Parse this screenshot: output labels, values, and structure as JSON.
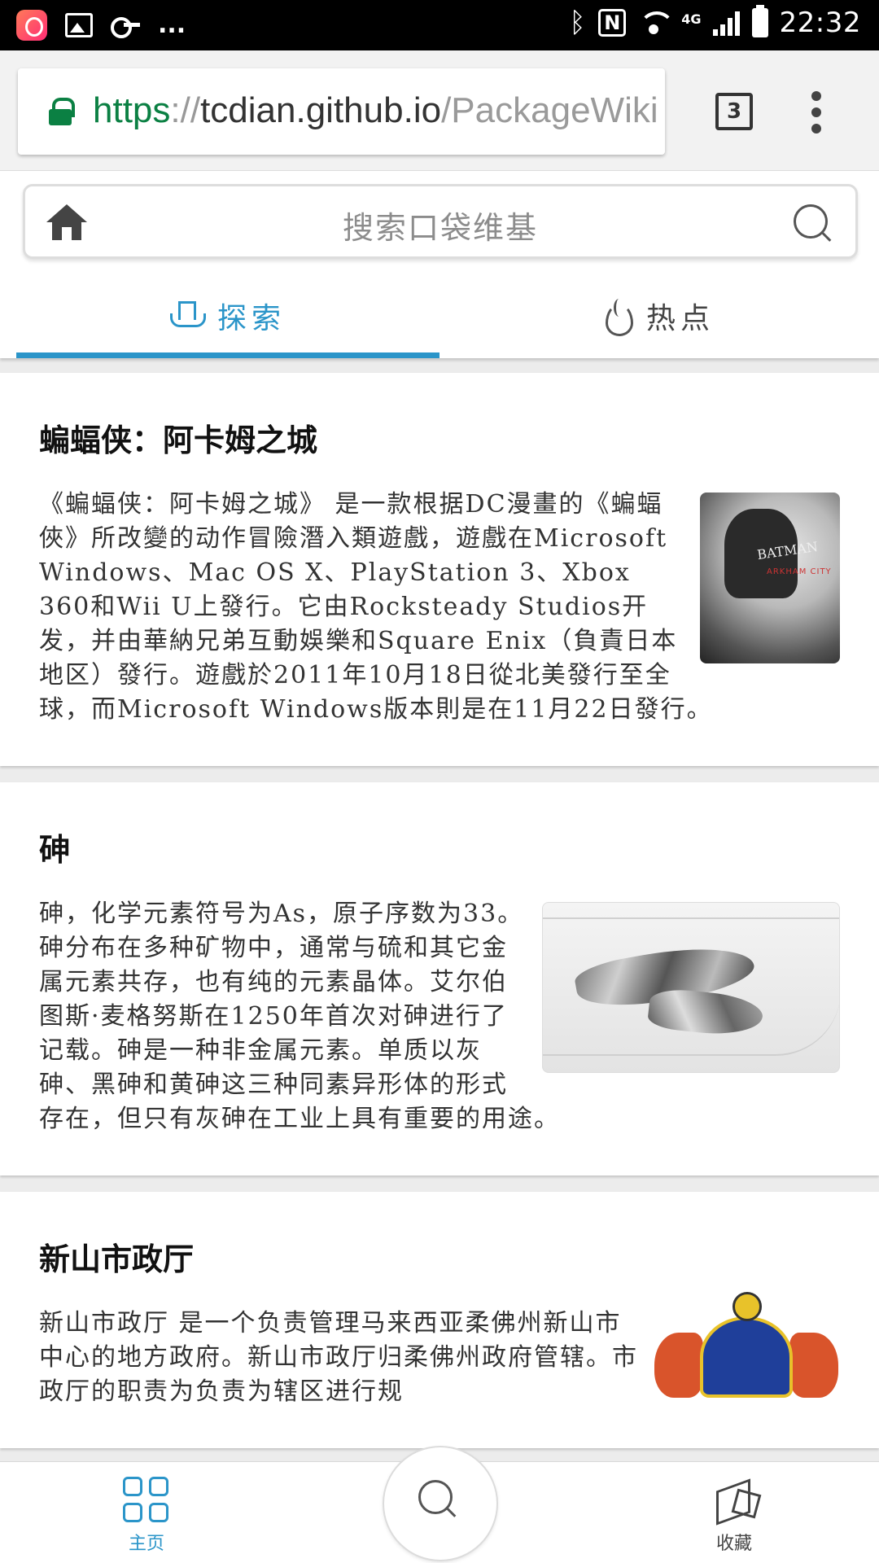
{
  "status_bar": {
    "overflow": "...",
    "network": "4G",
    "time": "22:32",
    "nfc": "N"
  },
  "browser": {
    "url_scheme": "https",
    "url_separator": "://",
    "url_host": "tcdian.github.io",
    "url_path": "/PackageWiki",
    "tab_count": "3"
  },
  "search": {
    "placeholder": "搜索口袋维基"
  },
  "tabs": [
    {
      "label": "探索",
      "icon": "ship-icon",
      "active": true
    },
    {
      "label": "热点",
      "icon": "flame-icon",
      "active": false
    }
  ],
  "colors": {
    "accent": "#2b95c9",
    "secure_green": "#0b8043"
  },
  "articles": [
    {
      "title": "蝙蝠侠：阿卡姆之城",
      "summary": "《蝙蝠侠：阿卡姆之城》 是一款根据DC漫畫的《蝙蝠俠》所改變的动作冒險潛入類遊戲，遊戲在Microsoft Windows、Mac OS X、PlayStation 3、Xbox 360和Wii U上發行。它由Rocksteady Studios开发，并由華納兄弟互動娛樂和Square Enix（負責日本地区）發行。遊戲於2011年10月18日從北美發行至全球，而Microsoft Windows版本則是在11月22日發行。",
      "image_text": "BATMAN",
      "image_subtext": "ARKHAM CITY"
    },
    {
      "title": "砷",
      "summary": "砷，化学元素符号为As，原子序数为33。砷分布在多种矿物中，通常与硫和其它金属元素共存，也有纯的元素晶体。艾尔伯图斯·麦格努斯在1250年首次对砷进行了记载。砷是一种非金属元素。单质以灰砷、黑砷和黄砷这三种同素异形体的形式存在，但只有灰砷在工业上具有重要的用途。"
    },
    {
      "title": "新山市政厅",
      "summary": "新山市政厅 是一个负责管理马来西亚柔佛州新山市中心的地方政府。新山市政厅归柔佛州政府管辖。市政厅的职责为负责为辖区进行规"
    }
  ],
  "bottom_nav": {
    "home_label": "主页",
    "favorites_label": "收藏"
  }
}
